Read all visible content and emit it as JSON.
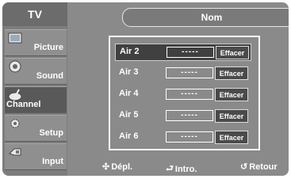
{
  "sidebar": {
    "header": "TV",
    "items": [
      {
        "label": "Picture",
        "icon": "picture-icon"
      },
      {
        "label": "Sound",
        "icon": "sound-icon"
      },
      {
        "label": "Channel",
        "icon": "channel-icon"
      },
      {
        "label": "Setup",
        "icon": "setup-icon"
      },
      {
        "label": "Input",
        "icon": "input-icon"
      }
    ]
  },
  "content": {
    "title": "Nom",
    "rows": [
      {
        "name": "Air 2",
        "value": "-----",
        "action": "Effacer"
      },
      {
        "name": "Air 3",
        "value": "-----",
        "action": "Effacer"
      },
      {
        "name": "Air 4",
        "value": "-----",
        "action": "Effacer"
      },
      {
        "name": "Air 5",
        "value": "-----",
        "action": "Effacer"
      },
      {
        "name": "Air 6",
        "value": "-----",
        "action": "Effacer"
      }
    ]
  },
  "footer": {
    "move": "Dépl.",
    "enter": "Intro.",
    "back": "Retour"
  }
}
